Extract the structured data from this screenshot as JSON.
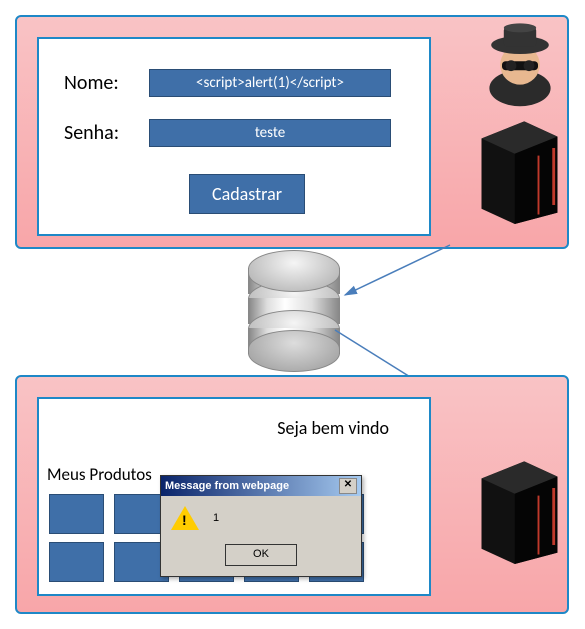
{
  "top_form": {
    "name_label": "Nome:",
    "name_value": "<script>alert(1)</script>",
    "password_label": "Senha:",
    "password_value": "teste",
    "submit_label": "Cadastrar"
  },
  "bottom_page": {
    "welcome": "Seja bem vindo",
    "products_title": "Meus Produtos"
  },
  "alert_dialog": {
    "title": "Message from webpage",
    "message": "1",
    "ok_label": "OK"
  }
}
